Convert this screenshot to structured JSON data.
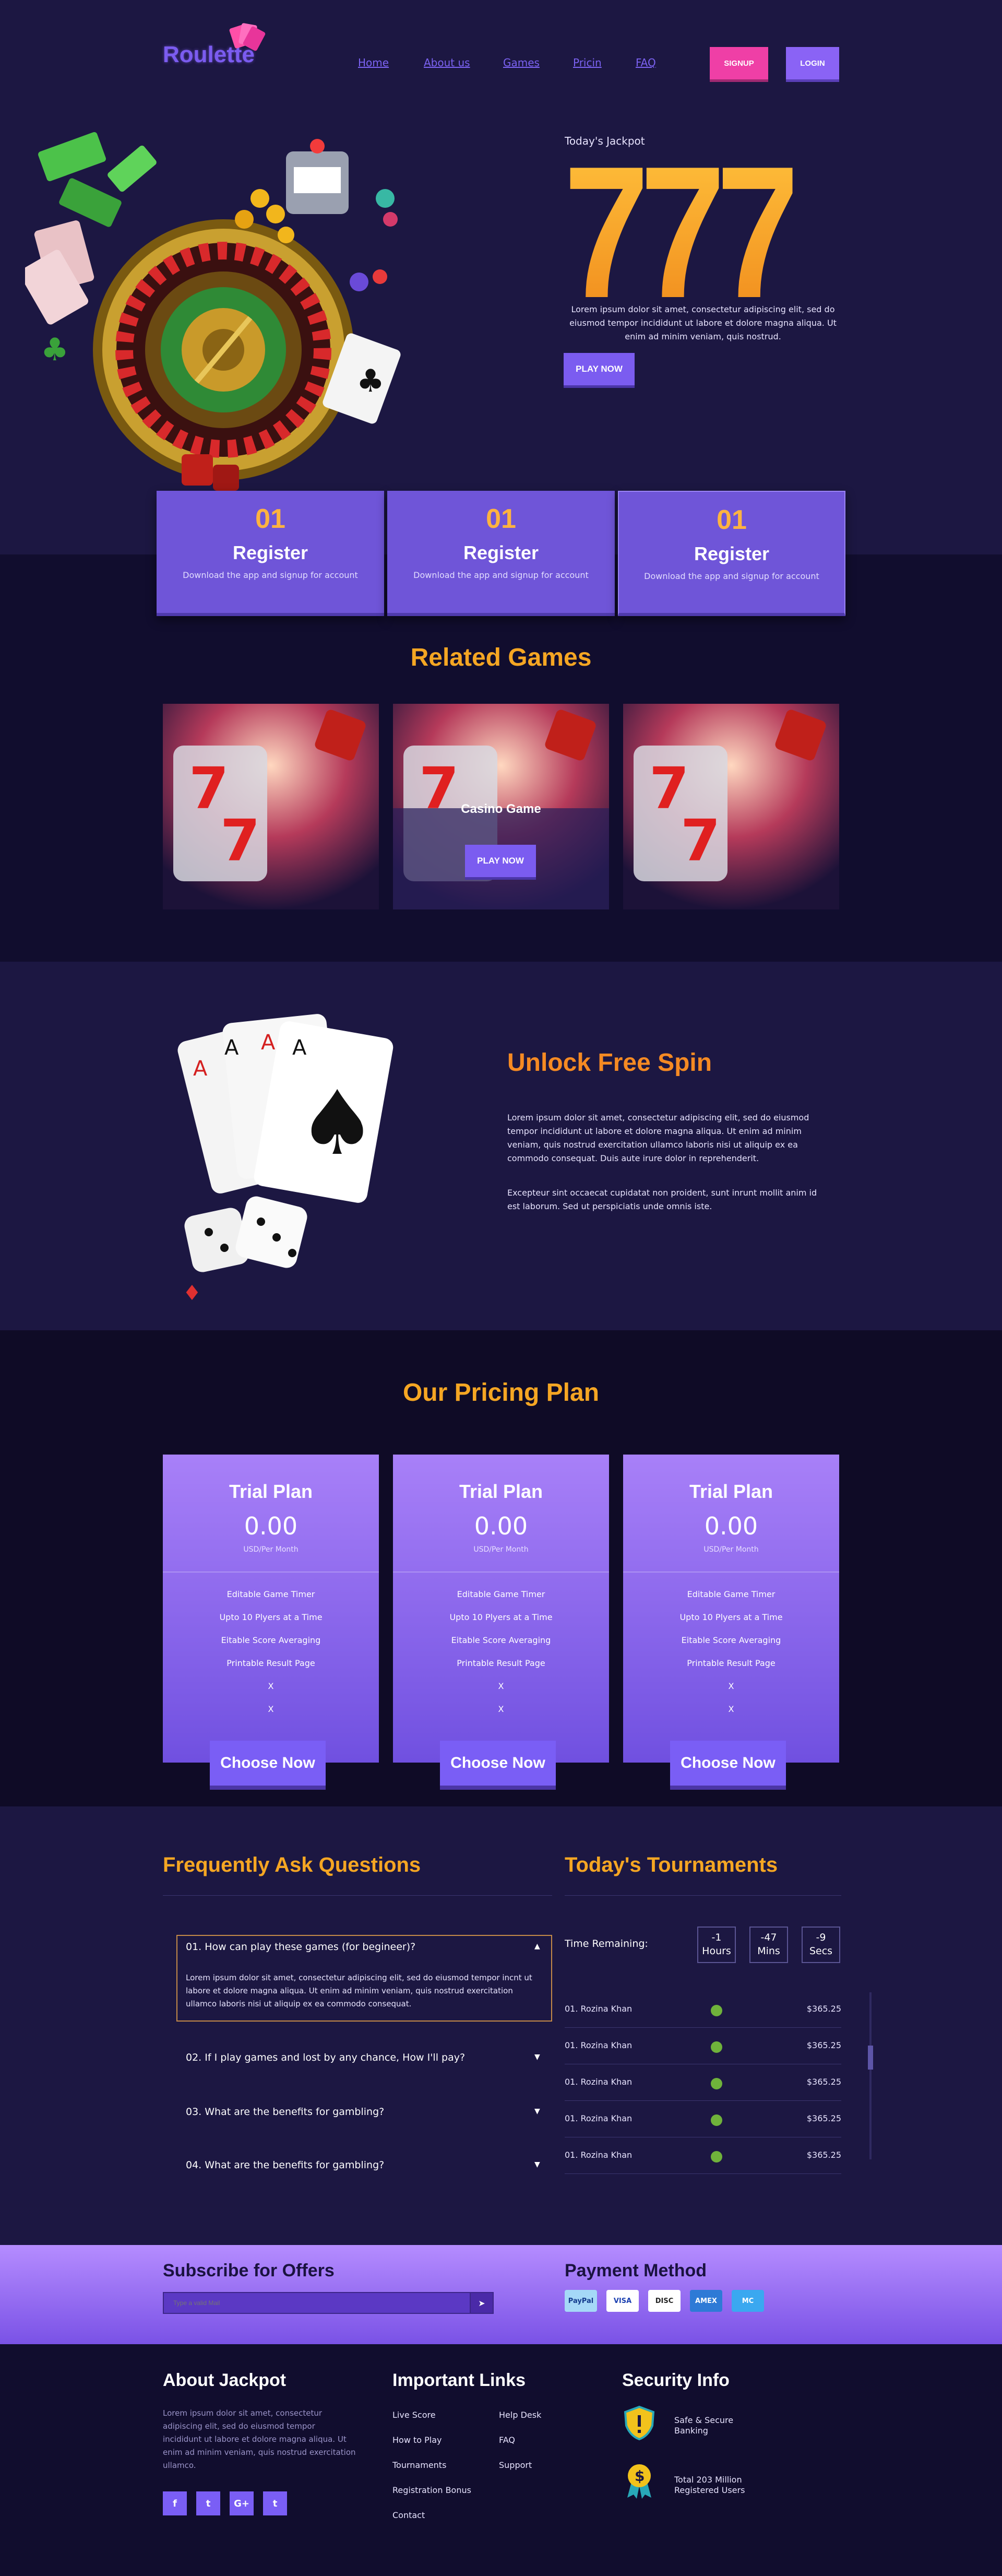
{
  "header": {
    "logo": "Roulette",
    "nav": [
      "Home",
      "About us",
      "Games",
      "Pricin",
      "FAQ"
    ],
    "signup": "SIGNUP",
    "login": "LOGIN"
  },
  "hero": {
    "jackpot_label": "Today's Jackpot",
    "jackpot_value": "777",
    "text": "Lorem ipsum dolor sit amet, consectetur adipiscing elit, sed do eiusmod tempor incididunt ut labore et dolore magna aliqua. Ut enim ad minim veniam, quis nostrud.",
    "play_button": "PLAY NOW"
  },
  "features": [
    {
      "num": "01",
      "title": "Register",
      "desc": "Download the app and signup for account"
    },
    {
      "num": "01",
      "title": "Register",
      "desc": "Download the app and signup for account"
    },
    {
      "num": "01",
      "title": "Register",
      "desc": "Download the app and signup for account"
    }
  ],
  "related": {
    "title": "Related Games",
    "hover_name": "Casino Game",
    "hover_button": "PLAY NOW"
  },
  "unlock": {
    "title": "Unlock Free Spin",
    "p1": "Lorem ipsum dolor sit amet, consectetur adipiscing elit, sed do eiusmod tempor incididunt ut labore et dolore magna aliqua. Ut enim ad minim veniam, quis nostrud exercitation ullamco laboris nisi ut aliquip ex ea commodo consequat. Duis aute irure dolor in reprehenderit.",
    "p2": "Excepteur sint occaecat cupidatat non proident, sunt inrunt mollit anim id est laborum. Sed ut perspiciatis unde omnis iste."
  },
  "pricing": {
    "title": "Our Pricing Plan",
    "plans": [
      {
        "name": "Trial Plan",
        "price": "0.00",
        "unit": "USD/Per Month",
        "features": [
          "Editable Game Timer",
          "Upto 10 Plyers at a Time",
          "Eitable Score Averaging",
          "Printable Result Page",
          "X",
          "X"
        ],
        "button": "Choose Now"
      },
      {
        "name": "Trial Plan",
        "price": "0.00",
        "unit": "USD/Per Month",
        "features": [
          "Editable Game Timer",
          "Upto 10 Plyers at a Time",
          "Eitable Score Averaging",
          "Printable Result Page",
          "X",
          "X"
        ],
        "button": "Choose Now"
      },
      {
        "name": "Trial Plan",
        "price": "0.00",
        "unit": "USD/Per Month",
        "features": [
          "Editable Game Timer",
          "Upto 10 Plyers at a Time",
          "Eitable Score Averaging",
          "Printable Result Page",
          "X",
          "X"
        ],
        "button": "Choose Now"
      }
    ]
  },
  "faq": {
    "title": "Frequently Ask Questions",
    "items": [
      {
        "q": "01. How can play these games (for begineer)?",
        "a": "Lorem ipsum dolor sit amet, consectetur adipiscing elit, sed do eiusmod tempor incnt ut labore et dolore magna aliqua. Ut enim ad minim veniam, quis nostrud exercitation ullamco laboris nisi ut aliquip ex ea commodo consequat."
      },
      {
        "q": "02. If I play games and lost by any chance, How I'll pay?"
      },
      {
        "q": "03. What are the benefits for gambling?"
      },
      {
        "q": "04. What are the benefits for gambling?"
      }
    ]
  },
  "tournaments": {
    "title": "Today's Tournaments",
    "time_label": "Time Remaining:",
    "timer": [
      {
        "value": "-1",
        "unit": "Hours"
      },
      {
        "value": "-47",
        "unit": "Mins"
      },
      {
        "value": "-9",
        "unit": "Secs"
      }
    ],
    "rows": [
      {
        "name": "01. Rozina Khan",
        "amount": "$365.25"
      },
      {
        "name": "01. Rozina Khan",
        "amount": "$365.25"
      },
      {
        "name": "01. Rozina Khan",
        "amount": "$365.25"
      },
      {
        "name": "01. Rozina Khan",
        "amount": "$365.25"
      },
      {
        "name": "01. Rozina Khan",
        "amount": "$365.25"
      }
    ]
  },
  "subscribe": {
    "title": "Subscribe for Offers",
    "placeholder": "Type a valid Mail"
  },
  "payment": {
    "title": "Payment Method",
    "cards": [
      "PayPal",
      "VISA",
      "DISC",
      "AMEX",
      "MC"
    ]
  },
  "footer": {
    "about_title": "About Jackpot",
    "about_text": "Lorem ipsum dolor sit amet, consectetur adipiscing elit, sed do eiusmod tempor incididunt ut labore et dolore magna aliqua. Ut enim ad minim veniam, quis nostrud exercitation ullamco.",
    "social": [
      "f",
      "t",
      "G+",
      "t"
    ],
    "links_title": "Important Links",
    "links_col1": [
      "Live Score",
      "How to Play",
      "Tournaments",
      "Registration Bonus",
      "Contact"
    ],
    "links_col2": [
      "Help Desk",
      "FAQ",
      "Support"
    ],
    "security_title": "Security Info",
    "security": [
      {
        "line1": "Safe & Secure",
        "line2": "Banking"
      },
      {
        "line1": "Total 203 Million",
        "line2": "Registered Users"
      }
    ]
  }
}
